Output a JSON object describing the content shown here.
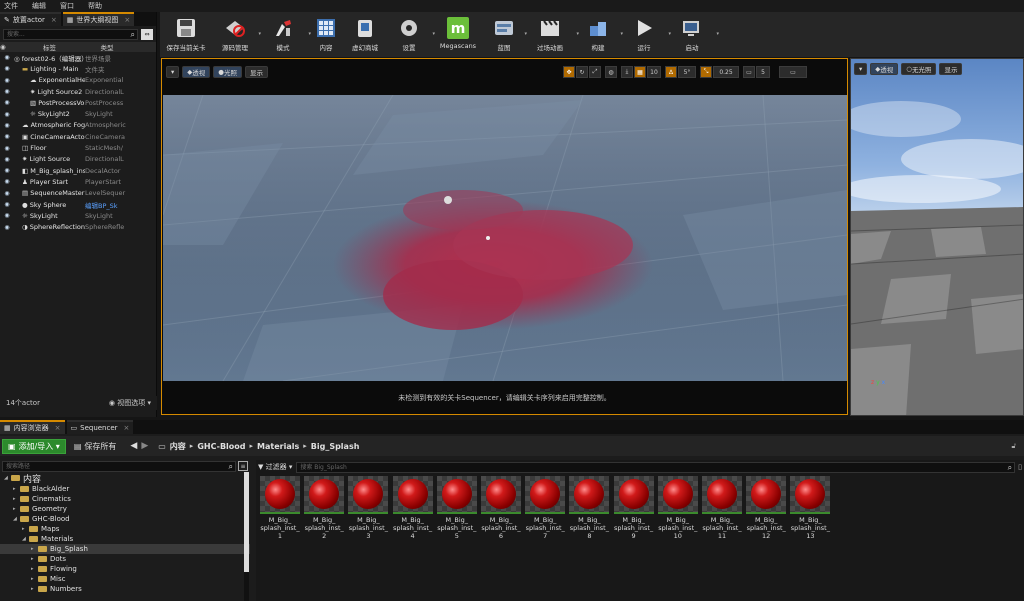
{
  "menu": [
    "文件",
    "编辑",
    "窗口",
    "帮助"
  ],
  "left_panel": {
    "tabs": [
      "放置actor",
      "世界大纲视图"
    ],
    "search_placeholder": "搜索...",
    "col_label": "标签",
    "col_type": "类型",
    "rows": [
      {
        "name": "forest02-6（编辑器）",
        "type": "世界场景"
      },
      {
        "name": "Lighting - Main",
        "type": "文件夹"
      },
      {
        "name": "ExponentialHeigh",
        "type": "Exponential"
      },
      {
        "name": "Light Source2",
        "type": "DirectionalL"
      },
      {
        "name": "PostProcessVolu",
        "type": "PostProcess"
      },
      {
        "name": "SkyLight2",
        "type": "SkyLight"
      },
      {
        "name": "Atmospheric Fog",
        "type": "Atmospheric"
      },
      {
        "name": "CineCameraActor1",
        "type": "CineCamera"
      },
      {
        "name": "Floor",
        "type": "StaticMesh/"
      },
      {
        "name": "Light Source",
        "type": "DirectionalL"
      },
      {
        "name": "M_Big_splash_inst",
        "type": "DecalActor"
      },
      {
        "name": "Player Start",
        "type": "PlayerStart"
      },
      {
        "name": "SequenceMaster",
        "type": "LevelSequer"
      },
      {
        "name": "Sky Sphere",
        "type": "编辑BP_Sk"
      },
      {
        "name": "SkyLight",
        "type": "SkyLight"
      },
      {
        "name": "SphereReflectionCa",
        "type": "SphereRefle"
      }
    ],
    "actor_count": "14个actor",
    "view_options": "视图选项"
  },
  "toolbar": [
    {
      "label": "保存当前关卡",
      "icon": "save-icon"
    },
    {
      "label": "源码管理",
      "icon": "source-control-icon"
    },
    {
      "label": "模式",
      "icon": "modes-icon"
    },
    {
      "label": "内容",
      "icon": "content-icon"
    },
    {
      "label": "虚幻商城",
      "icon": "marketplace-icon"
    },
    {
      "label": "设置",
      "icon": "settings-icon"
    },
    {
      "label": "Megascans",
      "icon": "megascans-icon"
    },
    {
      "label": "蓝图",
      "icon": "blueprint-icon"
    },
    {
      "label": "过场动画",
      "icon": "cinematics-icon"
    },
    {
      "label": "构建",
      "icon": "build-icon"
    },
    {
      "label": "运行",
      "icon": "play-icon"
    },
    {
      "label": "启动",
      "icon": "launch-icon"
    }
  ],
  "viewport": {
    "perspective": "透视",
    "lit": "光照",
    "show": "显示",
    "grid": "5°",
    "scale": "0.25",
    "speed": "5",
    "caption": "未检测到有效的关卡Sequencer，请编辑关卡序列来启用完整控制。"
  },
  "right_viewport": {
    "perspective": "透视",
    "unlit": "无光照",
    "show": "显示"
  },
  "content_browser": {
    "tabs": [
      "内容浏览器",
      "Sequencer"
    ],
    "add_import": "添加/导入",
    "save_all": "保存所有",
    "breadcrumbs": [
      "内容",
      "GHC-Blood",
      "Materials",
      "Big_Splash"
    ],
    "search_paths": "搜索路径",
    "filters": "过滤器",
    "search_placeholder": "搜索 Big_Splash",
    "tree": [
      {
        "label": "内容",
        "level": 0
      },
      {
        "label": "BlackAlder",
        "level": 1
      },
      {
        "label": "Cinematics",
        "level": 1
      },
      {
        "label": "Geometry",
        "level": 1
      },
      {
        "label": "GHC-Blood",
        "level": 1
      },
      {
        "label": "Maps",
        "level": 2
      },
      {
        "label": "Materials",
        "level": 2
      },
      {
        "label": "Big_Splash",
        "level": 3
      },
      {
        "label": "Dots",
        "level": 3
      },
      {
        "label": "Flowing",
        "level": 3
      },
      {
        "label": "Misc",
        "level": 3
      },
      {
        "label": "Numbers",
        "level": 3
      }
    ],
    "assets": [
      {
        "line1": "M_Big_",
        "line2": "splash_inst_",
        "line3": "1"
      },
      {
        "line1": "M_Big_",
        "line2": "splash_inst_",
        "line3": "2"
      },
      {
        "line1": "M_Big_",
        "line2": "splash_inst_",
        "line3": "3"
      },
      {
        "line1": "M_Big_",
        "line2": "splash_inst_",
        "line3": "4"
      },
      {
        "line1": "M_Big_",
        "line2": "splash_inst_",
        "line3": "5"
      },
      {
        "line1": "M_Big_",
        "line2": "splash_inst_",
        "line3": "6"
      },
      {
        "line1": "M_Big_",
        "line2": "splash_inst_",
        "line3": "7"
      },
      {
        "line1": "M_Big_",
        "line2": "splash_inst_",
        "line3": "8"
      },
      {
        "line1": "M_Big_",
        "line2": "splash_inst_",
        "line3": "9"
      },
      {
        "line1": "M_Big_",
        "line2": "splash_inst_",
        "line3": "10"
      },
      {
        "line1": "M_Big_",
        "line2": "splash_inst_",
        "line3": "11"
      },
      {
        "line1": "M_Big_",
        "line2": "splash_inst_",
        "line3": "12"
      },
      {
        "line1": "M_Big_",
        "line2": "splash_inst_",
        "line3": "13"
      }
    ]
  },
  "colors": {
    "accent": "#d58a00",
    "green": "#2c8a2c",
    "blood": "#b3203a"
  }
}
